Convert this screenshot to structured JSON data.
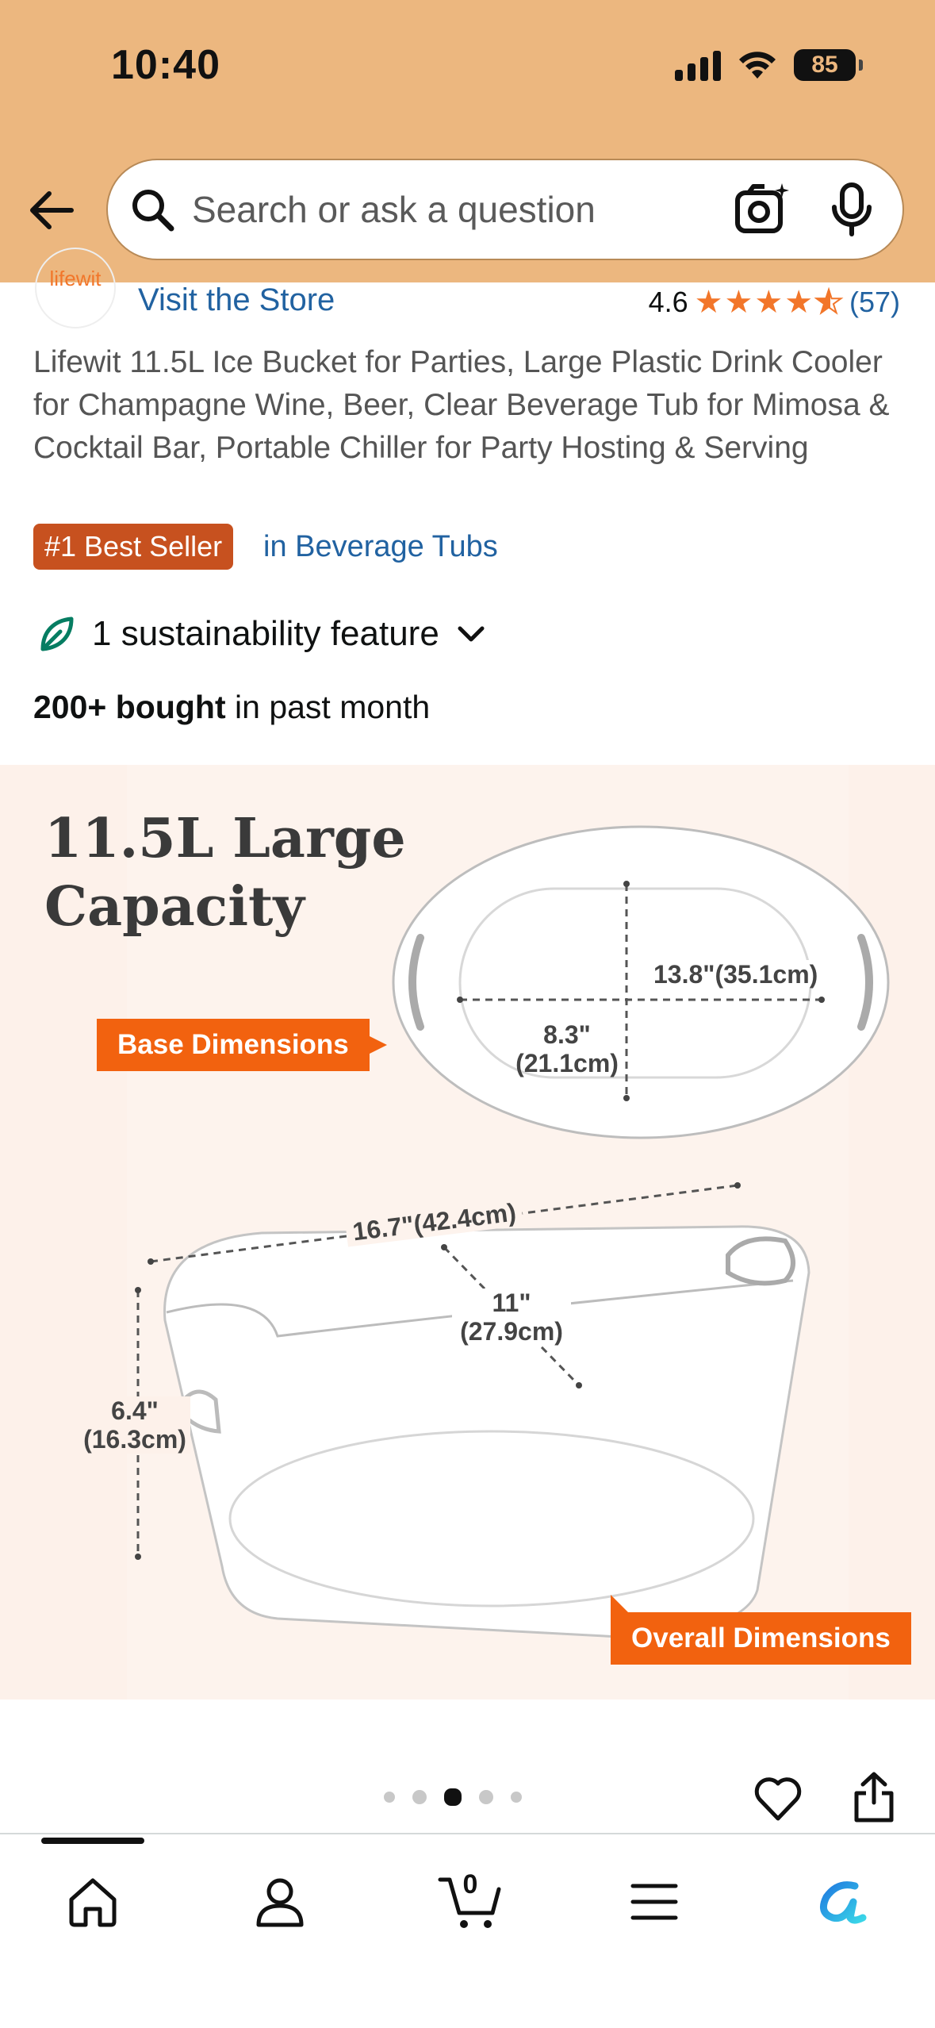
{
  "status_bar": {
    "time": "10:40",
    "battery": "85"
  },
  "header": {
    "search_placeholder": "Search or ask a question"
  },
  "store": {
    "logo_text": "lifewit",
    "visit_label": "Visit the Store",
    "rating": "4.6",
    "rating_stars": 4.6,
    "rating_count": "(57)"
  },
  "product": {
    "title": "Lifewit 11.5L Ice Bucket for Parties, Large Plastic Drink Cooler for Champagne Wine, Beer, Clear Beverage Tub for Mimosa & Cocktail Bar, Portable Chiller for Party Hosting & Serving",
    "badge": "#1 Best Seller",
    "badge_category": "in Beverage Tubs",
    "sustainability": "1 sustainability feature",
    "bought_bold": "200+ bought",
    "bought_rest": " in past month"
  },
  "image": {
    "caption_line1": "11.5L Large",
    "caption_line2": "Capacity",
    "base_tag": "Base Dimensions",
    "overall_tag": "Overall Dimensions",
    "base_length": "13.8\"(35.1cm)",
    "base_width_in": "8.3\"",
    "base_width_cm": "(21.1cm)",
    "overall_length": "16.7\"(42.4cm)",
    "overall_width_in": "11\"",
    "overall_width_cm": "(27.9cm)",
    "height_in": "6.4\"",
    "height_cm": "(16.3cm)"
  },
  "carousel": {
    "total": 5,
    "active_index": 2
  },
  "nav": {
    "cart_count": "0",
    "items": [
      "home-icon",
      "account-icon",
      "cart-icon",
      "menu-icon",
      "rufus-icon"
    ]
  }
}
